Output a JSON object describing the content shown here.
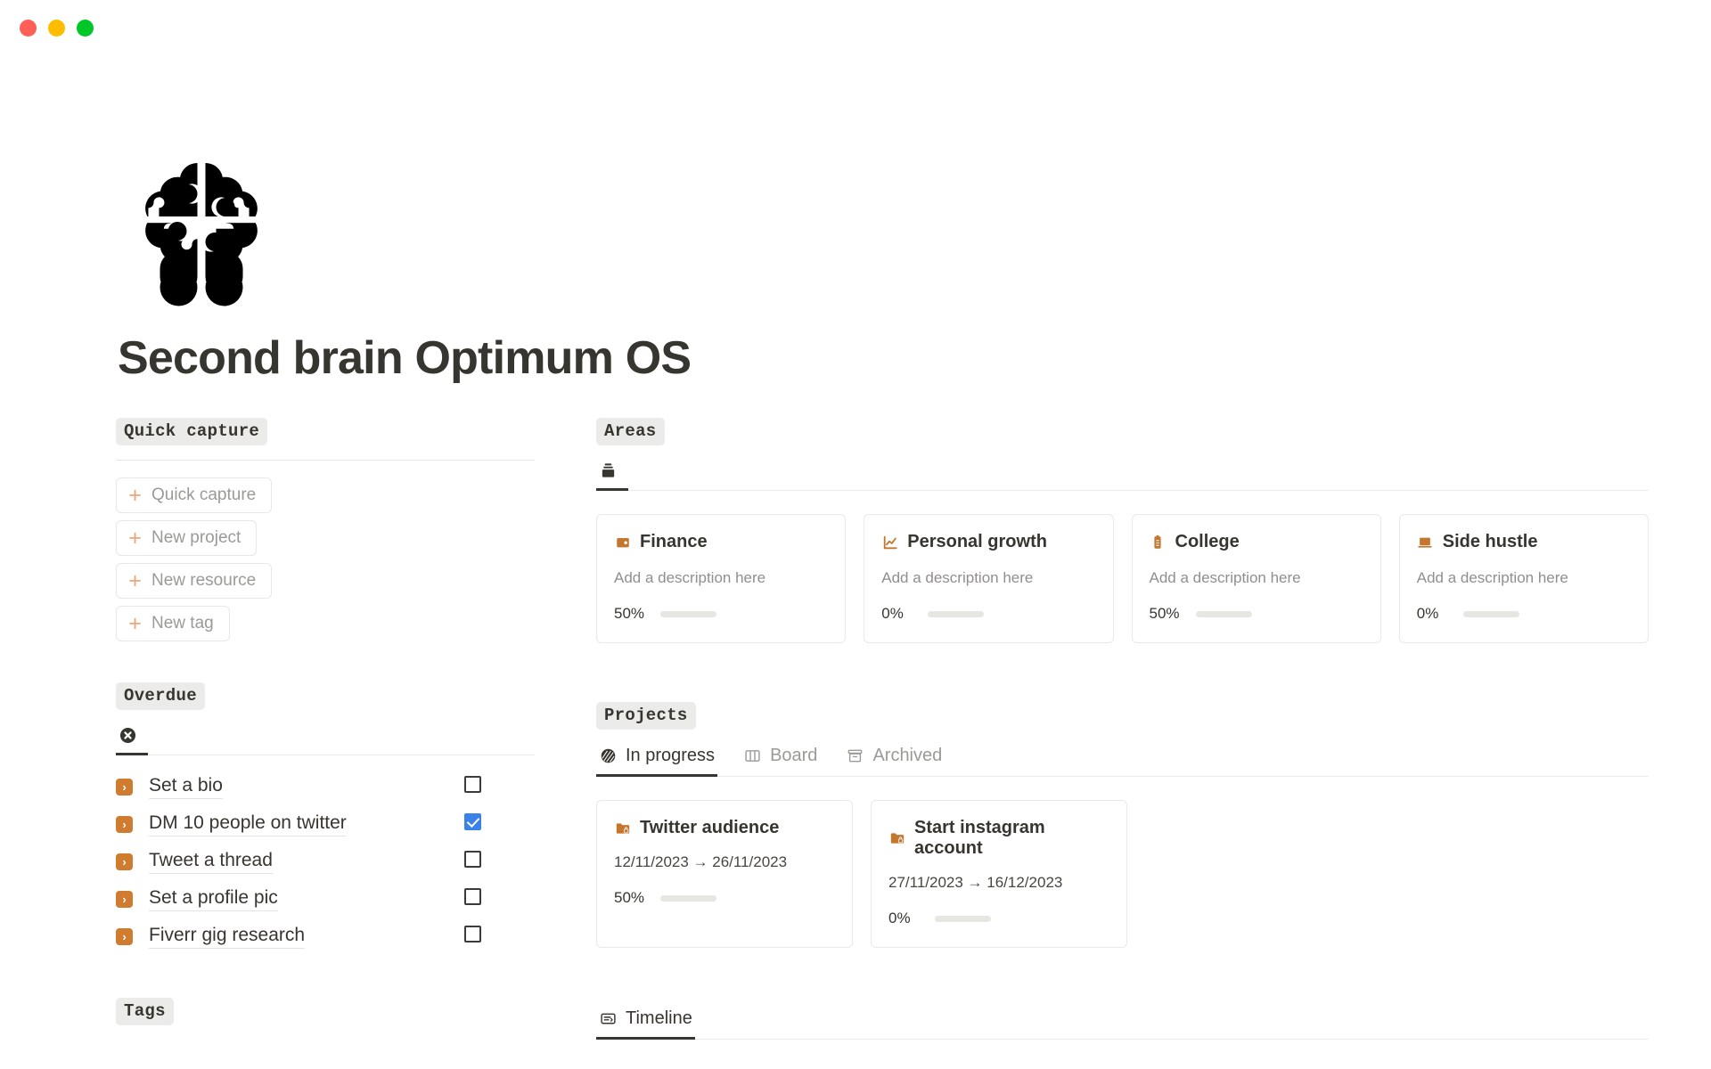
{
  "window": {
    "close_label": "close",
    "minimize_label": "minimize",
    "maximize_label": "maximize"
  },
  "header": {
    "title": "Second brain Optimum OS",
    "logo_name": "brain-puzzle-logo"
  },
  "colors": {
    "accent_orange": "#c4762f",
    "chip_orange": "#cf7b30",
    "plus_orange": "#e8a87c",
    "checkbox_blue": "#3b82e8",
    "badge_bg": "#ebebe9",
    "text": "#37352f",
    "muted": "#9b9a97",
    "track": "#e6e6e3",
    "traffic_red": "#ff5f57",
    "traffic_amber": "#ffbd00",
    "traffic_green": "#00c728"
  },
  "sidebar": {
    "quick_capture": {
      "badge": "Quick capture",
      "buttons": [
        {
          "label": "Quick capture",
          "icon": "plus-icon"
        },
        {
          "label": "New project",
          "icon": "plus-icon"
        },
        {
          "label": "New resource",
          "icon": "plus-icon"
        },
        {
          "label": "New tag",
          "icon": "plus-icon"
        }
      ]
    },
    "overdue": {
      "badge": "Overdue",
      "tabs": [
        {
          "label": "",
          "icon": "x-circle-icon",
          "active": true
        }
      ],
      "tasks": [
        {
          "name": "Set a bio",
          "checked": false,
          "chip": "chevron-right-icon"
        },
        {
          "name": "DM 10 people on twitter",
          "checked": true,
          "chip": "chevron-right-icon"
        },
        {
          "name": "Tweet a thread",
          "checked": false,
          "chip": "chevron-right-icon"
        },
        {
          "name": "Set a profile pic",
          "checked": false,
          "chip": "chevron-right-icon"
        },
        {
          "name": "Fiverr gig research",
          "checked": false,
          "chip": "chevron-right-icon"
        }
      ]
    },
    "tags": {
      "badge": "Tags"
    }
  },
  "areas": {
    "badge": "Areas",
    "tabs": [
      {
        "label": "",
        "icon": "archive-stack-icon",
        "active": true
      }
    ],
    "cards": [
      {
        "title": "Finance",
        "icon": "wallet-icon",
        "description": "Add a description here",
        "percent_label": "50%",
        "percent": 50
      },
      {
        "title": "Personal growth",
        "icon": "line-chart-icon",
        "description": "Add a description here",
        "percent_label": "0%",
        "percent": 0
      },
      {
        "title": "College",
        "icon": "clipboard-icon",
        "description": "Add a description here",
        "percent_label": "50%",
        "percent": 50
      },
      {
        "title": "Side hustle",
        "icon": "laptop-icon",
        "description": "Add a description here",
        "percent_label": "0%",
        "percent": 0
      }
    ]
  },
  "projects": {
    "badge": "Projects",
    "tabs": [
      {
        "label": "In progress",
        "icon": "sphere-icon",
        "active": true
      },
      {
        "label": "Board",
        "icon": "columns-icon",
        "active": false
      },
      {
        "label": "Archived",
        "icon": "archive-icon",
        "active": false
      }
    ],
    "cards": [
      {
        "title": "Twitter audience",
        "icon": "folder-lock-icon",
        "dates": "12/11/2023 → 26/11/2023",
        "percent_label": "50%",
        "percent": 50
      },
      {
        "title": "Start instagram account",
        "icon": "folder-lock-icon",
        "dates": "27/11/2023 → 16/12/2023",
        "percent_label": "0%",
        "percent": 0
      }
    ]
  },
  "timeline": {
    "tabs": [
      {
        "label": "Timeline",
        "icon": "timeline-card-icon",
        "active": true
      }
    ]
  }
}
